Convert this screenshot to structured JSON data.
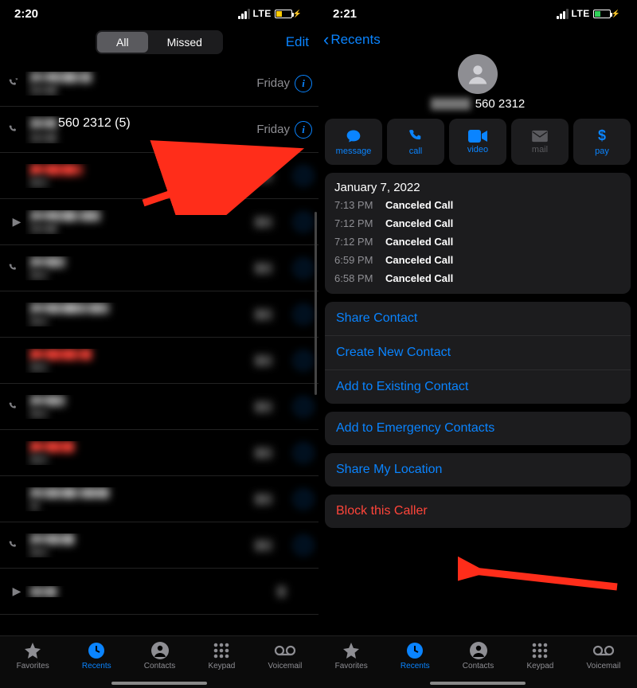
{
  "left": {
    "status_time": "2:20",
    "net_label": "LTE",
    "seg_all": "All",
    "seg_missed": "Missed",
    "edit": "Edit",
    "rows": [
      {
        "day": "Friday"
      },
      {
        "num_display": "560 2312 (5)",
        "day": "Friday"
      }
    ],
    "day_label": "Friday"
  },
  "right": {
    "status_time": "2:21",
    "net_label": "LTE",
    "back_label": "Recents",
    "number_suffix": "560 2312",
    "actions": {
      "message": "message",
      "call": "call",
      "video": "video",
      "mail": "mail",
      "pay": "pay"
    },
    "history": {
      "date": "January 7, 2022",
      "calls": [
        {
          "t": "7:13 PM",
          "d": "Canceled Call"
        },
        {
          "t": "7:12 PM",
          "d": "Canceled Call"
        },
        {
          "t": "7:12 PM",
          "d": "Canceled Call"
        },
        {
          "t": "6:59 PM",
          "d": "Canceled Call"
        },
        {
          "t": "6:58 PM",
          "d": "Canceled Call"
        }
      ]
    },
    "options": {
      "share": "Share Contact",
      "create": "Create New Contact",
      "add_existing": "Add to Existing Contact",
      "emergency": "Add to Emergency Contacts",
      "location": "Share My Location",
      "block": "Block this Caller"
    }
  },
  "tabs": {
    "favorites": "Favorites",
    "recents": "Recents",
    "contacts": "Contacts",
    "keypad": "Keypad",
    "voicemail": "Voicemail"
  }
}
